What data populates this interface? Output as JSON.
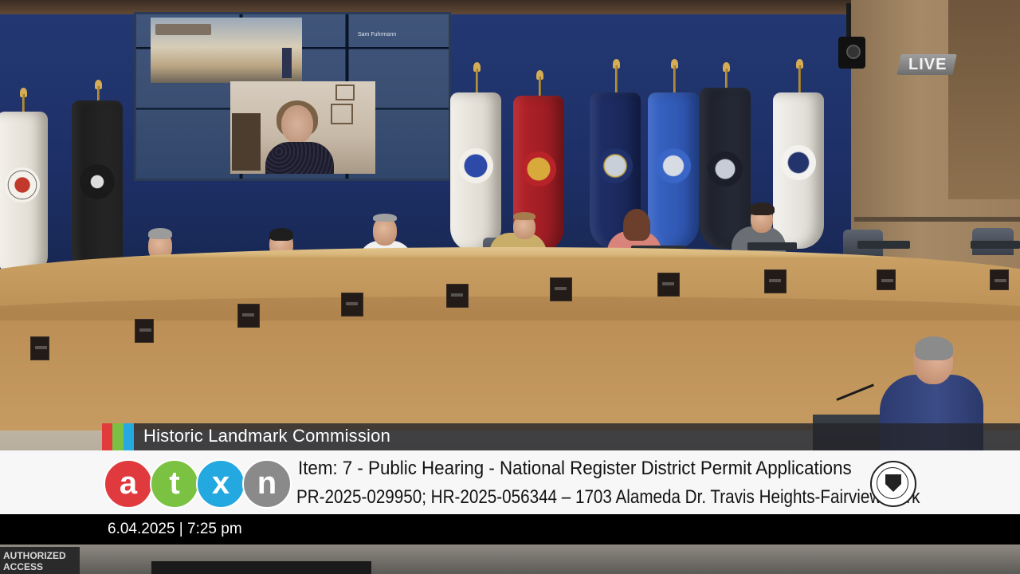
{
  "broadcast": {
    "live_label": "LIVE",
    "commission_title": "Historic Landmark Commission",
    "item_line": "Item: 7 - Public Hearing - National Register District Permit Applications",
    "case_line": "PR-2025-029950; HR-2025-056344 – 1703 Alameda Dr. Travis Heights-Fairview Park",
    "date_time": "6.04.2025 | 7:25 pm",
    "title_accent_colors": [
      "#e23b3b",
      "#7ac143",
      "#25a9e0"
    ]
  },
  "logo": {
    "letters": [
      "a",
      "t",
      "x",
      "n"
    ],
    "colors": [
      "#e03a3e",
      "#7cc242",
      "#24a8e0",
      "#8a8a8a"
    ]
  },
  "video_wall": {
    "participant_name": "Sam Fuhrmann"
  },
  "room": {
    "sign_text": "AUTHORIZED ACCESS"
  },
  "icons": {
    "city_seal": "city-of-austin-seal-icon",
    "live": "live-badge-icon"
  }
}
